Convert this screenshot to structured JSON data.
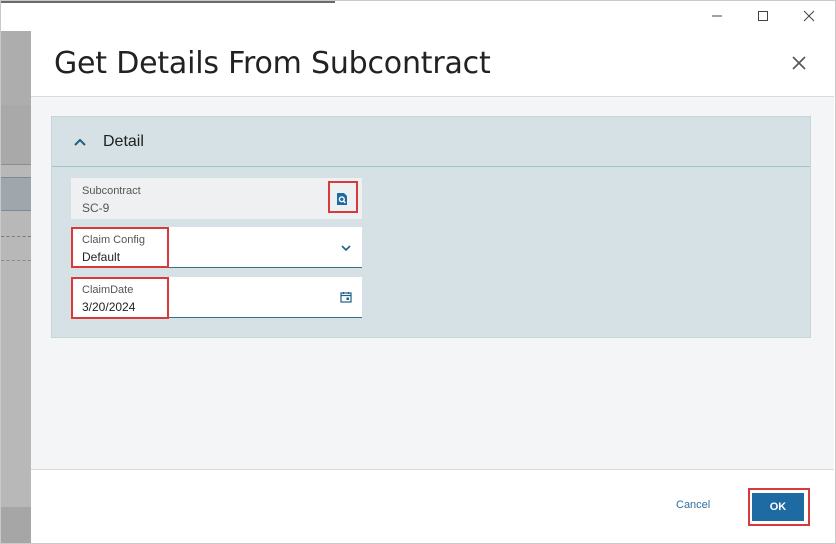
{
  "window": {
    "controls": {
      "minimize": "minimize-icon",
      "maximize": "maximize-icon",
      "close": "close-icon"
    }
  },
  "dialog": {
    "title": "Get Details From Subcontract",
    "close_icon": "close-icon",
    "section": {
      "title": "Detail",
      "expanded": true,
      "fields": {
        "subcontract": {
          "label": "Subcontract",
          "value": "SC-9",
          "icon": "search-icon",
          "readonly": true
        },
        "claim_config": {
          "label": "Claim Config",
          "value": "Default",
          "icon": "chevron-down-icon"
        },
        "claim_date": {
          "label": "ClaimDate",
          "value": "3/20/2024",
          "icon": "calendar-icon"
        }
      }
    },
    "footer": {
      "cancel_label": "Cancel",
      "ok_label": "OK"
    }
  },
  "colors": {
    "accent": "#1e6aa3",
    "highlight": "#d63a3a",
    "section_bg": "#d6e1e5"
  }
}
